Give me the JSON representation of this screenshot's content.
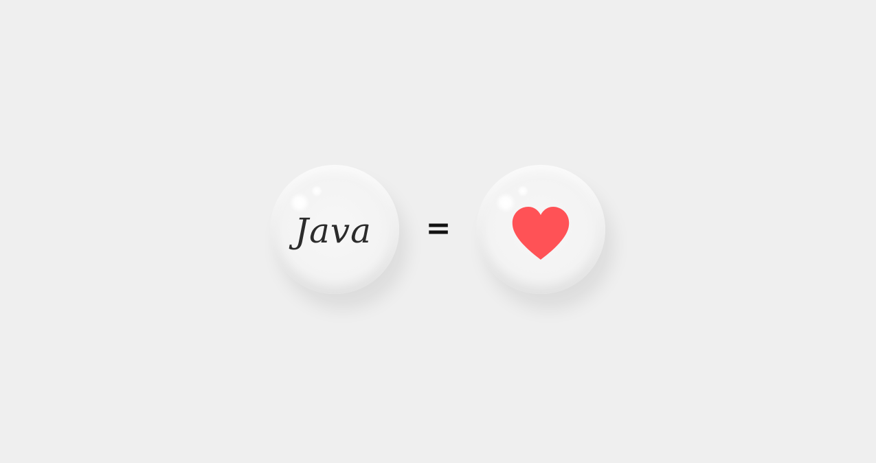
{
  "left_bubble": {
    "label": "Java"
  },
  "operator": {
    "symbol": "="
  },
  "right_bubble": {
    "icon": "heart-icon"
  },
  "colors": {
    "background": "#efefef",
    "heart": "#ff5256",
    "text": "#2b2b2b"
  }
}
